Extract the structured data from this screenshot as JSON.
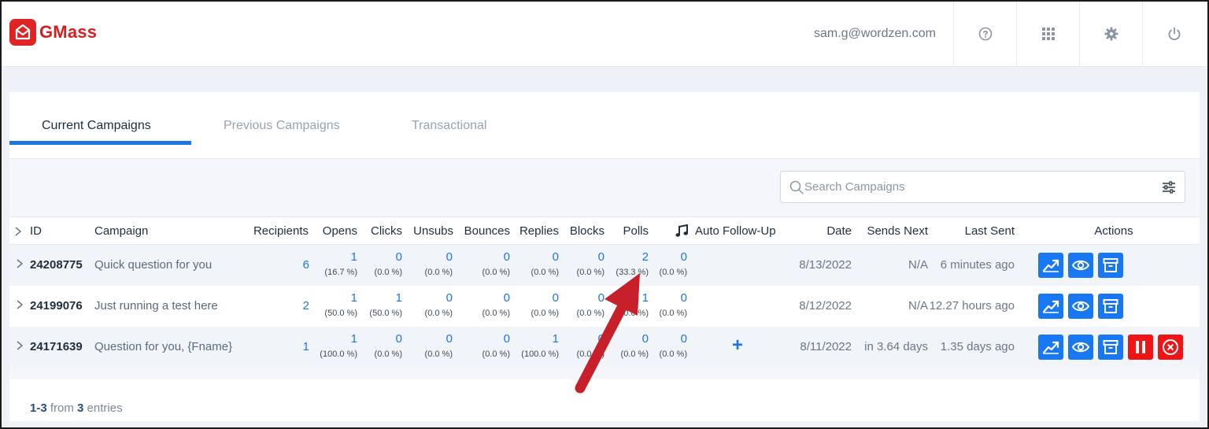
{
  "header": {
    "app_name": "GMass",
    "user_email": "sam.g@wordzen.com",
    "icons": [
      "help-icon",
      "apps-grid-icon",
      "settings-gear-icon",
      "power-icon"
    ],
    "brand_color": "#e02424"
  },
  "tabs": [
    {
      "label": "Current Campaigns",
      "active": true
    },
    {
      "label": "Previous Campaigns",
      "active": false
    },
    {
      "label": "Transactional",
      "active": false
    }
  ],
  "search": {
    "placeholder": "Search Campaigns",
    "value": ""
  },
  "columns": {
    "id": "ID",
    "campaign": "Campaign",
    "recipients": "Recipients",
    "opens": "Opens",
    "clicks": "Clicks",
    "unsubs": "Unsubs",
    "bounces": "Bounces",
    "replies": "Replies",
    "blocks": "Blocks",
    "polls": "Polls",
    "auto_follow_up": "Auto Follow-Up",
    "date": "Date",
    "sends_next": "Sends Next",
    "last_sent": "Last Sent",
    "actions": "Actions"
  },
  "rows": [
    {
      "id": "24208775",
      "campaign": "Quick question for you",
      "recipients": "6",
      "opens": "1",
      "opens_pct": "(16.7 %)",
      "clicks": "0",
      "clicks_pct": "(0.0 %)",
      "unsubs": "0",
      "unsubs_pct": "(0.0 %)",
      "bounces": "0",
      "bounces_pct": "(0.0 %)",
      "replies": "0",
      "replies_pct": "(0.0 %)",
      "blocks": "0",
      "blocks_pct": "(0.0 %)",
      "polls": "2",
      "polls_pct": "(33.3 %)",
      "music": "0",
      "music_pct": "(0.0 %)",
      "auto_follow_up": "",
      "date": "8/13/2022",
      "sends_next": "N/A",
      "last_sent": "6 minutes ago"
    },
    {
      "id": "24199076",
      "campaign": "Just running a test here",
      "recipients": "2",
      "opens": "1",
      "opens_pct": "(50.0 %)",
      "clicks": "1",
      "clicks_pct": "(50.0 %)",
      "unsubs": "0",
      "unsubs_pct": "(0.0 %)",
      "bounces": "0",
      "bounces_pct": "(0.0 %)",
      "replies": "0",
      "replies_pct": "(0.0 %)",
      "blocks": "0",
      "blocks_pct": "(0.0 %)",
      "polls": "1",
      "polls_pct": "(50.0 %)",
      "music": "0",
      "music_pct": "(0.0 %)",
      "auto_follow_up": "",
      "date": "8/12/2022",
      "sends_next": "N/A",
      "last_sent": "12.27 hours ago"
    },
    {
      "id": "24171639",
      "campaign": "Question for you, {Fname}",
      "recipients": "1",
      "opens": "1",
      "opens_pct": "(100.0 %)",
      "clicks": "0",
      "clicks_pct": "(0.0 %)",
      "unsubs": "0",
      "unsubs_pct": "(0.0 %)",
      "bounces": "0",
      "bounces_pct": "(0.0 %)",
      "replies": "1",
      "replies_pct": "(100.0 %)",
      "blocks": "0",
      "blocks_pct": "(0.0 %)",
      "polls": "0",
      "polls_pct": "(0.0 %)",
      "music": "0",
      "music_pct": "(0.0 %)",
      "auto_follow_up": "+",
      "date": "8/11/2022",
      "sends_next": "in 3.64 days",
      "last_sent": "1.35 days ago"
    }
  ],
  "actions": {
    "standard": [
      "report-chart-icon",
      "view-eye-icon",
      "archive-box-icon"
    ],
    "extra": [
      "pause-icon",
      "cancel-x-icon"
    ],
    "button_color": "#1877f2",
    "danger_color": "#f21414"
  },
  "footer": {
    "range": "1-3",
    "from_label": "from",
    "total": "3",
    "entries_label": "entries"
  },
  "annotation": {
    "arrow_color": "#c8202a",
    "points_to": "Polls"
  }
}
